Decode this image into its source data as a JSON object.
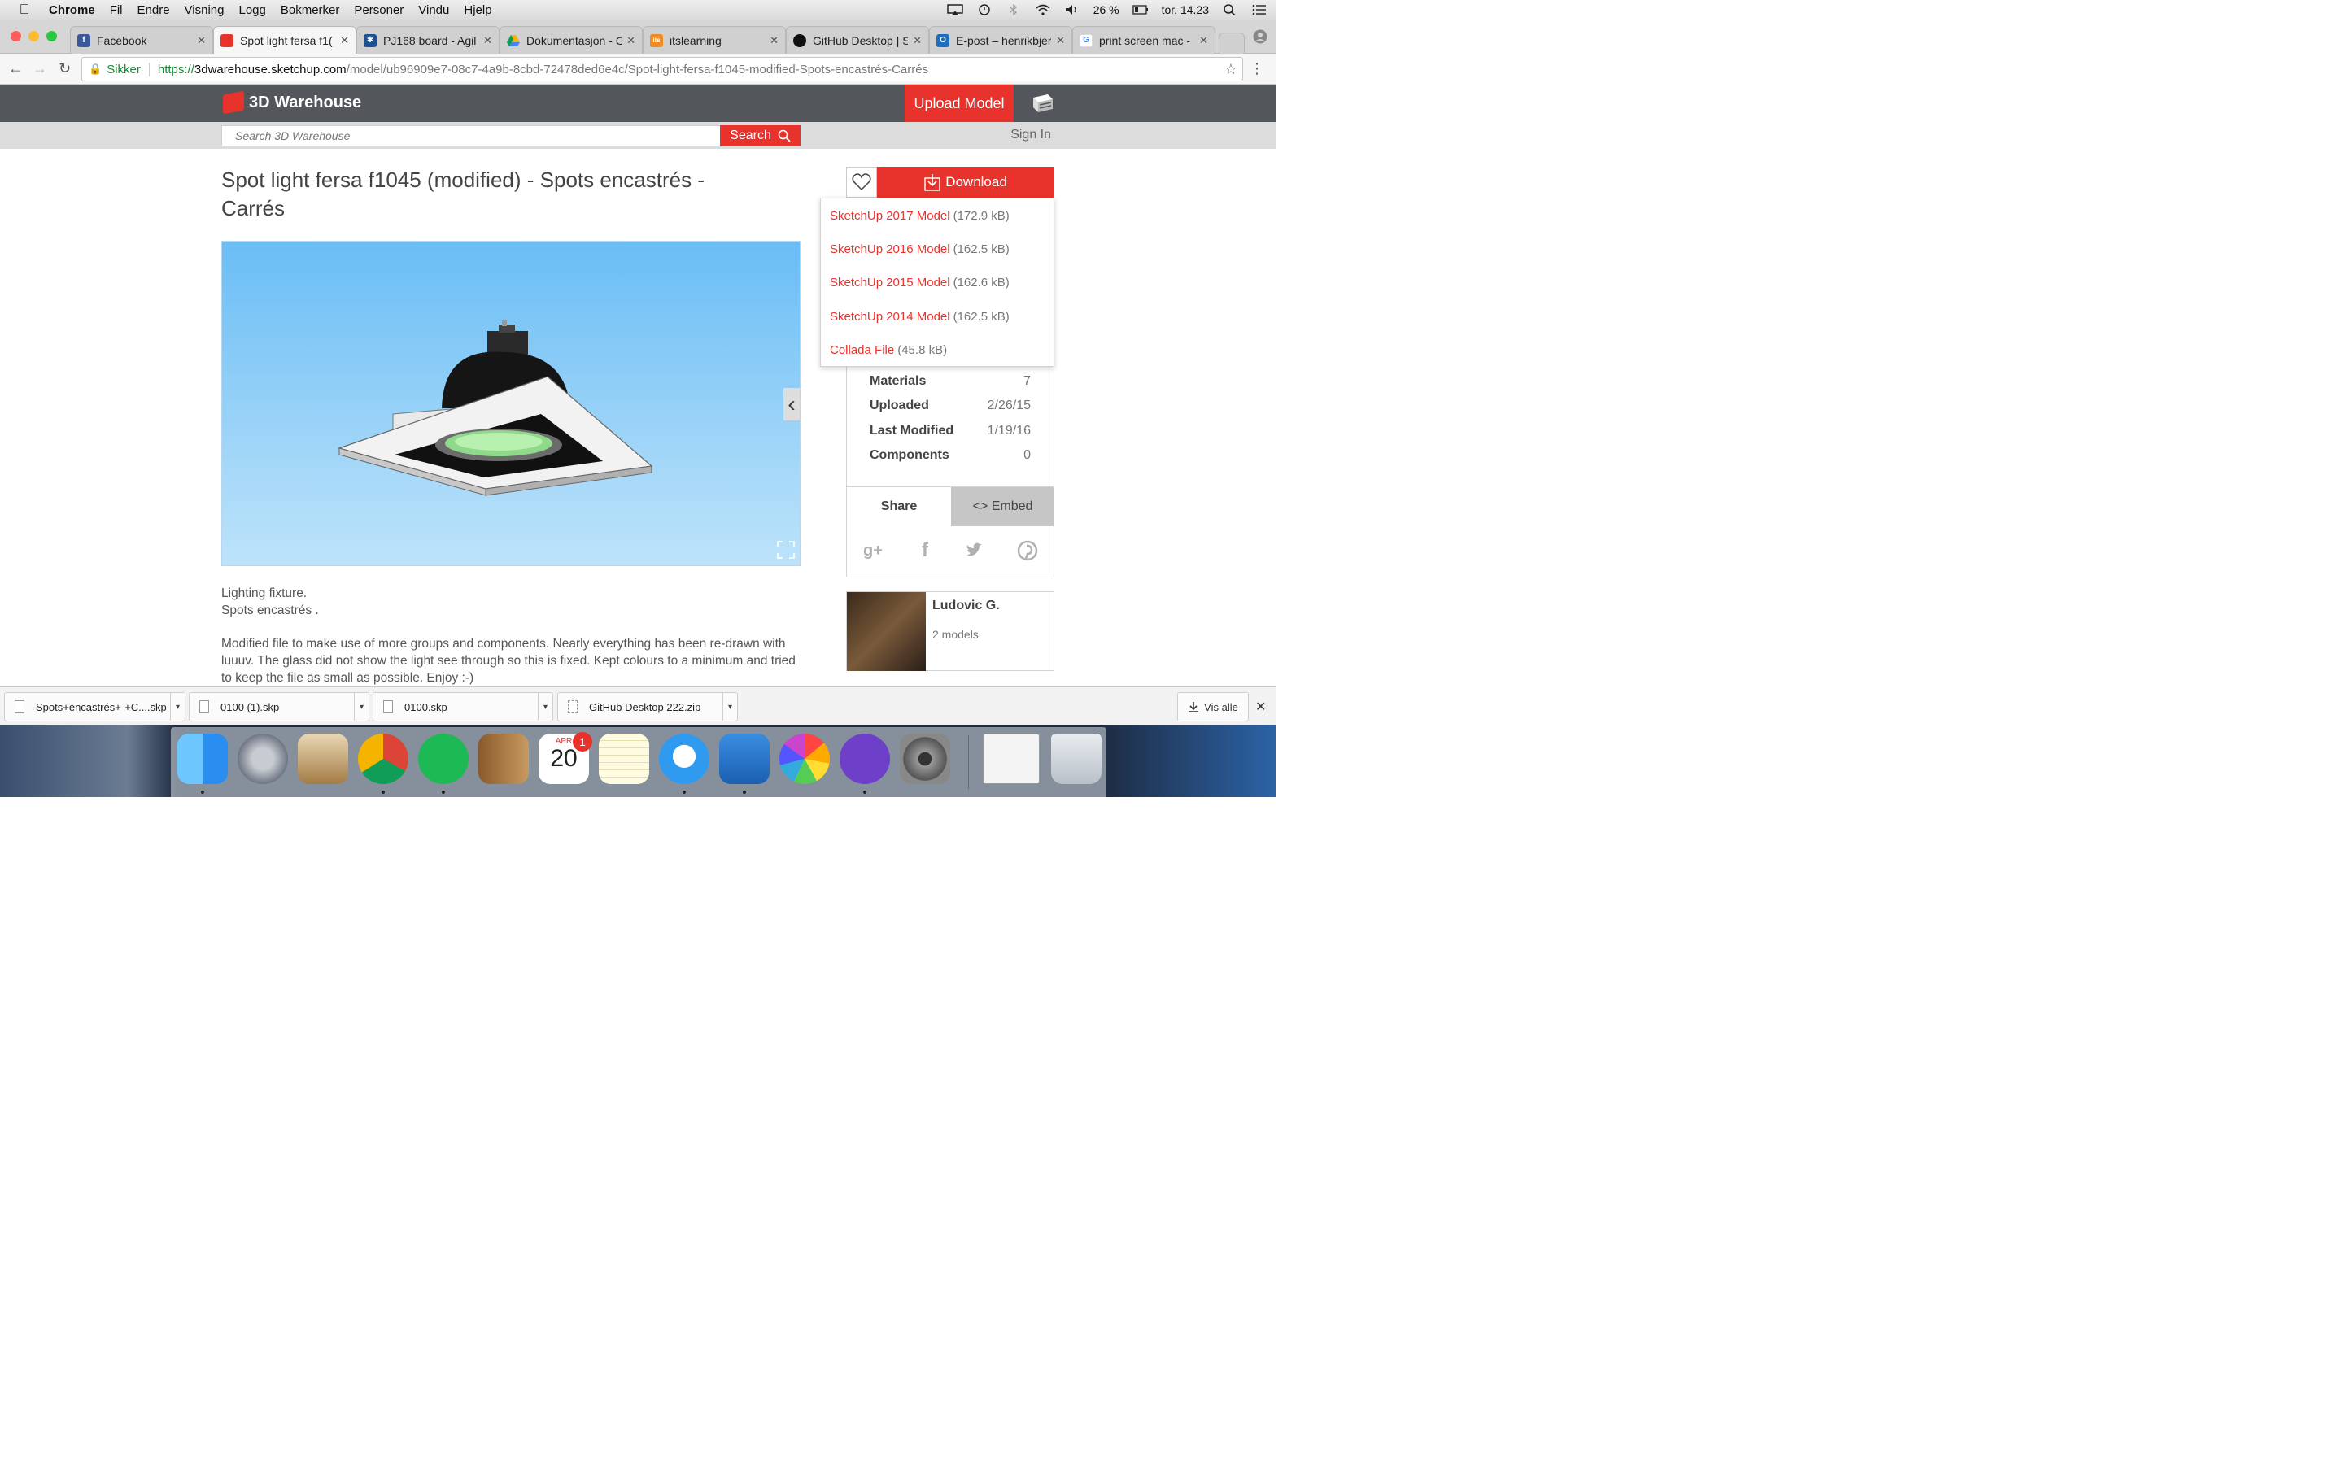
{
  "menubar": {
    "app_name": "Chrome",
    "items": [
      "Fil",
      "Endre",
      "Visning",
      "Logg",
      "Bokmerker",
      "Personer",
      "Vindu",
      "Hjelp"
    ],
    "battery": "26 %",
    "clock": "tor. 14.23"
  },
  "tabs": [
    {
      "title": "Facebook",
      "favicon": "facebook-icon",
      "color": "#3b5998",
      "letter": "f"
    },
    {
      "title": "Spot light fersa f1(",
      "favicon": "3dwarehouse-icon",
      "color": "#e8322c",
      "letter": ""
    },
    {
      "title": "PJ168 board - Agil",
      "favicon": "jira-icon",
      "color": "#1d4f91",
      "letter": ""
    },
    {
      "title": "Dokumentasjon - G",
      "favicon": "drive-icon",
      "color": "#f4b400",
      "letter": ""
    },
    {
      "title": "itslearning",
      "favicon": "itslearning-icon",
      "color": "#f08a24",
      "letter": "its"
    },
    {
      "title": "GitHub Desktop | S",
      "favicon": "github-icon",
      "color": "#111111",
      "letter": ""
    },
    {
      "title": "E-post – henrikbjer",
      "favicon": "outlook-icon",
      "color": "#1b6ec2",
      "letter": "O"
    },
    {
      "title": "print screen mac -",
      "favicon": "google-icon",
      "color": "#4285f4",
      "letter": "G"
    }
  ],
  "address": {
    "secure_label": "Sikker",
    "scheme": "https://",
    "host": "3dwarehouse.sketchup.com",
    "path": "/model/ub96909e7-08c7-4a9b-8cbd-72478ded6e4c/Spot-light-fersa-f1045-modified-Spots-encastrés-Carrés"
  },
  "site": {
    "logo_text": "3D Warehouse",
    "upload_label": "Upload Model",
    "search_placeholder": "Search 3D Warehouse",
    "search_label": "Search",
    "signin_label": "Sign In",
    "accent": "#e8322c"
  },
  "model": {
    "title": "Spot light fersa f1045 (modified) - Spots encastrés - Carrés",
    "description_line1": "Lighting fixture.",
    "description_line2": "Spots encastrés .",
    "description_para": "Modified file to make use of more groups and components. Nearly everything has been re-drawn with luuuv. The glass did not show the light see through so this is fixed. Kept colours to a minimum and tried to keep the file as small as possible. Enjoy :-)"
  },
  "download": {
    "label": "Download",
    "options": [
      {
        "name": "SketchUp 2017 Model",
        "size": "(172.9 kB)"
      },
      {
        "name": "SketchUp 2016 Model",
        "size": "(162.5 kB)"
      },
      {
        "name": "SketchUp 2015 Model",
        "size": "(162.6 kB)"
      },
      {
        "name": "SketchUp 2014 Model",
        "size": "(162.5 kB)"
      },
      {
        "name": "Collada File",
        "size": "(45.8 kB)"
      }
    ]
  },
  "meta": [
    {
      "key": "Materials",
      "value": "7"
    },
    {
      "key": "Uploaded",
      "value": "2/26/15"
    },
    {
      "key": "Last Modified",
      "value": "1/19/16"
    },
    {
      "key": "Components",
      "value": "0"
    }
  ],
  "share": {
    "share_label": "Share",
    "embed_label": "<> Embed",
    "networks": [
      "google-plus-icon",
      "facebook-icon",
      "twitter-icon",
      "pinterest-icon"
    ]
  },
  "author": {
    "name": "Ludovic G.",
    "models": "2 models"
  },
  "downloads_shelf": {
    "files": [
      "Spots+encastrés+-+C....skp",
      "0100 (1).skp",
      "0100.skp",
      "GitHub Desktop 222.zip"
    ],
    "show_all": "Vis alle"
  },
  "dock": {
    "apps": [
      "finder-icon",
      "launchpad-icon",
      "mail-icon",
      "chrome-icon",
      "spotify-icon",
      "contacts-icon",
      "calendar-icon",
      "notes-icon",
      "messages-icon",
      "openoffice-icon",
      "photos-icon",
      "github-desktop-icon",
      "system-preferences-icon",
      "document-icon",
      "trash-icon"
    ],
    "calendar_month": "APR",
    "calendar_day": "20",
    "badge": "1"
  }
}
